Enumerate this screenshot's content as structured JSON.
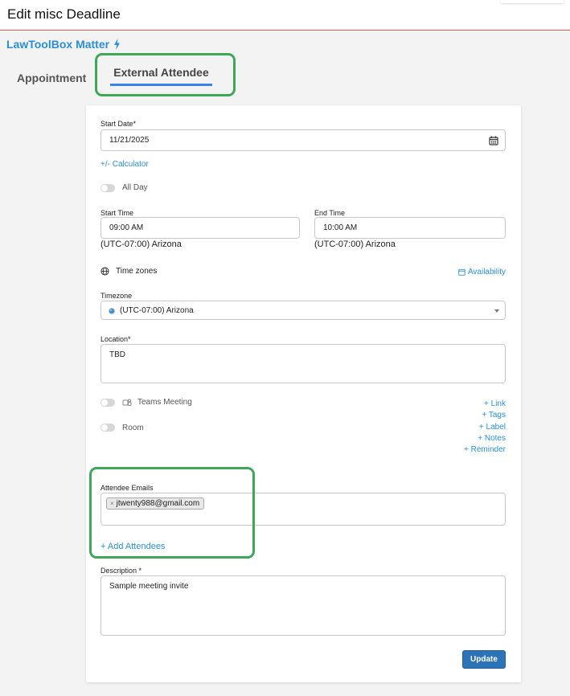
{
  "header": {
    "title": "Edit misc Deadline"
  },
  "matter_link": {
    "label": "LawToolBox Matter",
    "icon": "lightning-icon"
  },
  "tabs": [
    {
      "label": "Appointment",
      "active": false
    },
    {
      "label": "External Attendee",
      "active": true
    }
  ],
  "form": {
    "start_date": {
      "label": "Start Date*",
      "value": "11/21/2025",
      "icon": "calendar-icon"
    },
    "calculator_link": "+/- Calculator",
    "all_day": {
      "label": "All Day",
      "on": false
    },
    "start_time": {
      "label": "Start Time",
      "value": "09:00 AM",
      "tz": "(UTC-07:00) Arizona"
    },
    "end_time": {
      "label": "End Time",
      "value": "10:00 AM",
      "tz": "(UTC-07:00) Arizona"
    },
    "time_zones": {
      "label": "Time zones",
      "icon": "globe-icon"
    },
    "availability_link": "Availability",
    "timezone": {
      "label": "Timezone",
      "value": "(UTC-07:00) Arizona"
    },
    "location": {
      "label": "Location*",
      "value": "TBD"
    },
    "teams_meeting": {
      "label": "Teams Meeting",
      "on": false
    },
    "room": {
      "label": "Room",
      "on": false
    },
    "side_links": {
      "link": "+ Link",
      "tags": "+ Tags",
      "label": "+ Label",
      "notes": "+ Notes",
      "reminder": "+ Reminder"
    },
    "attendees": {
      "label": "Attendee Emails",
      "chips": [
        "jtwenty988@gmail.com"
      ],
      "add_link": "+ Add Attendees"
    },
    "description": {
      "label": "Description *",
      "value": "Sample meeting invite"
    },
    "update_button": "Update"
  },
  "colors": {
    "accent": "#2a8fd6",
    "tab_underline": "#3b82e6",
    "highlight": "#3fa75a",
    "button": "#2c73b8",
    "header_border": "#e05a5a"
  }
}
